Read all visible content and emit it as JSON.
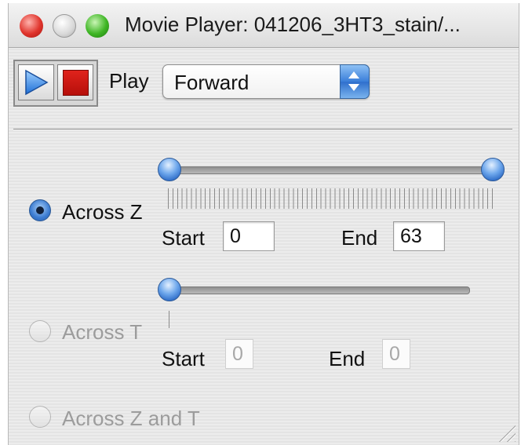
{
  "window": {
    "title": "Movie Player: 041206_3HT3_stain/..."
  },
  "controls": {
    "play_label": "Play",
    "direction": {
      "selected": "Forward"
    }
  },
  "across_z": {
    "label": "Across Z",
    "selected": true,
    "start_label": "Start",
    "start_value": "0",
    "end_label": "End",
    "end_value": "63"
  },
  "across_t": {
    "label": "Across T",
    "selected": false,
    "enabled": false,
    "start_label": "Start",
    "start_value": "0",
    "end_label": "End",
    "end_value": "0"
  },
  "across_zt": {
    "label": "Across Z and T",
    "selected": false,
    "enabled": false
  },
  "colors": {
    "accent_blue": "#3a7ed9",
    "stop_red": "#d01a14",
    "disabled_text": "#9c9c9c"
  }
}
